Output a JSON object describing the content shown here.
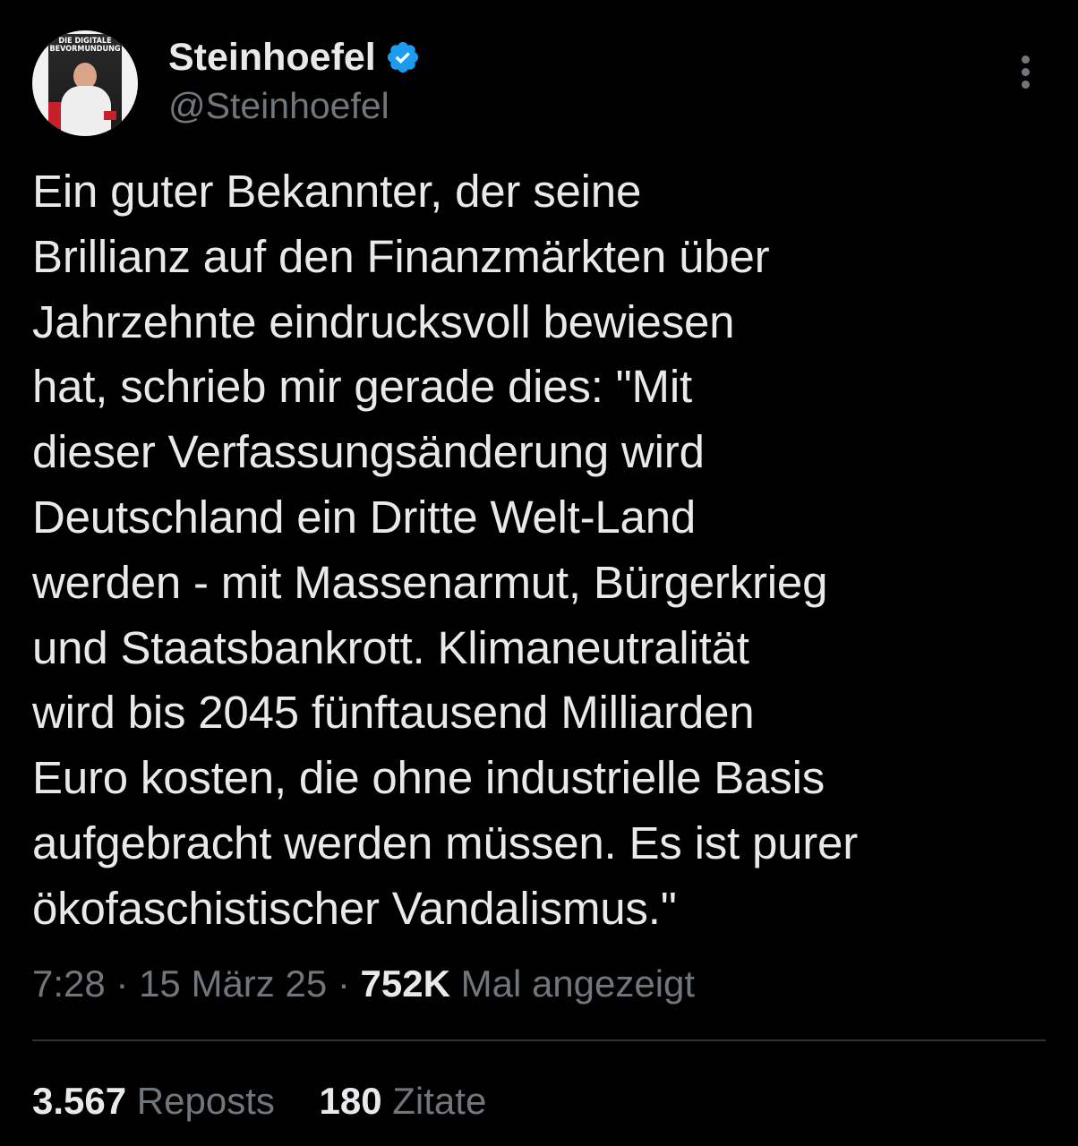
{
  "author": {
    "display_name": "Steinhoefel",
    "handle": "@Steinhoefel",
    "verified": true,
    "avatar_text": "DIE DIGITALE BEVORMUNDUNG"
  },
  "tweet": {
    "text": "Ein guter Bekannter, der seine\nBrillianz auf den Finanzmärkten über\nJahrzehnte eindrucksvoll bewiesen\nhat, schrieb mir gerade dies: \"Mit\ndieser Verfassungsänderung wird\nDeutschland ein Dritte Welt-Land\nwerden - mit Massenarmut, Bürgerkrieg\nund Staatsbankrott. Klimaneutralität\nwird bis 2045 fünftausend Milliarden\nEuro kosten, die ohne industrielle Basis\naufgebracht werden müssen. Es ist purer\nökofaschistischer Vandalismus.\"",
    "time": "7:28",
    "separator": " · ",
    "date": "15 März 25",
    "views_count": "752K",
    "views_label": "Mal angezeigt"
  },
  "stats": {
    "reposts_count": "3.567",
    "reposts_label": "Reposts",
    "quotes_count": "180",
    "quotes_label": "Zitate"
  },
  "icons": {
    "verified": "verified-badge-icon",
    "more": "more-options-icon"
  },
  "colors": {
    "background": "#000000",
    "text_primary": "#e7e9ea",
    "text_secondary": "#71767b",
    "verified_blue": "#1d9bf0",
    "divider": "#2f3336"
  }
}
